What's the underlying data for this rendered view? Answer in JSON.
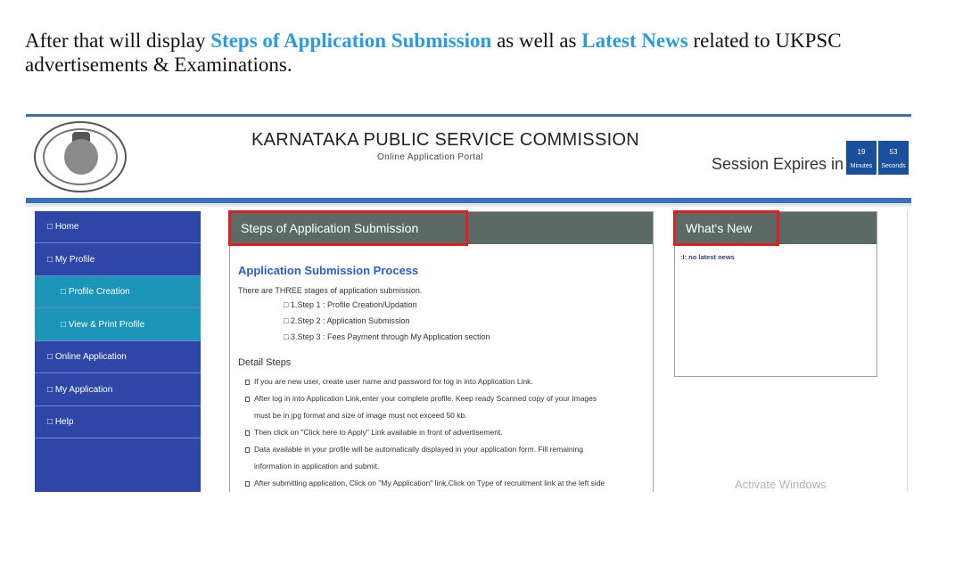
{
  "intro": {
    "part1": "After that will display ",
    "highlight1": "Steps of Application Submission",
    "part2": " as well as ",
    "highlight2": "Latest News",
    "part3": " related to UKPSC advertisements & Examinations."
  },
  "header": {
    "title": "KARNATAKA PUBLIC SERVICE COMMISSION",
    "subtitle": "Online Application Portal",
    "session_label": "Session Expires in",
    "minutes_value": "19",
    "minutes_unit": "Minutes",
    "seconds_value": "53",
    "seconds_unit": "Seconds"
  },
  "sidebar": {
    "items": [
      {
        "label": "□ Home"
      },
      {
        "label": "□ My Profile"
      },
      {
        "label": "□ Profile Creation"
      },
      {
        "label": "□ View & Print Profile"
      },
      {
        "label": "□ Online Application"
      },
      {
        "label": "□ My Application"
      },
      {
        "label": "□ Help"
      }
    ]
  },
  "steps": {
    "heading": "Steps of Application Submission",
    "process_title": "Application Submission Process",
    "intro": "There are THREE stages of application submission.",
    "stages": [
      "□ 1.Step 1 : Profile Creation/Updation",
      "□ 2.Step 2 : Application Submission",
      "□ 3.Step 3 : Fees Payment through My Application section"
    ],
    "detail_title": "Detail Steps",
    "details": [
      "If you are new user, create user name and password for log in into Application Link.",
      "After log in into Application Link,enter your complete profile. Keep ready Scanned copy of your Images",
      "must be in jpg format and size of image must not exceed 50 kb.",
      "Then click on \"Click here to Apply\" Link available in front of advertisement.",
      "Data available in your profile will be automatically displayed in your application form. Fill remaining",
      "information in application and submit.",
      "After submitting application, Click on \"My Application\" link.Click on Type of recruitment link at the left side"
    ]
  },
  "news": {
    "heading": "What's New",
    "item": ":I: no latest news"
  },
  "watermark": "Activate Windows",
  "colors": {
    "accent_blue": "#2a9be0",
    "sidebar_blue": "#2e47a6",
    "sidebar_sub": "#1c95b8",
    "panel_header": "#5c6a65",
    "highlight_red": "#e02020"
  }
}
